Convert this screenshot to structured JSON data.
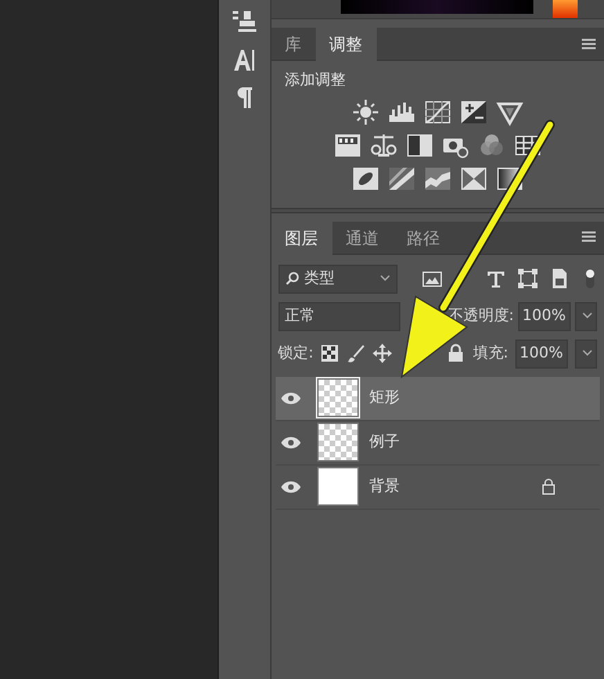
{
  "adjust_panel": {
    "tabs": [
      {
        "label": "库",
        "selected": false
      },
      {
        "label": "调整",
        "selected": true
      }
    ],
    "heading": "添加调整"
  },
  "layers_panel": {
    "tabs": [
      {
        "label": "图层",
        "selected": true
      },
      {
        "label": "通道",
        "selected": false
      },
      {
        "label": "路径",
        "selected": false
      }
    ],
    "filter": {
      "value": "类型"
    },
    "blend_mode": "正常",
    "opacity_label": "不透明度:",
    "opacity": "100%",
    "lock_label": "锁定:",
    "fill_label": "填充:",
    "fill": "100%",
    "layers": [
      {
        "name": "矩形",
        "selected": true,
        "visible": true,
        "locked": false,
        "kind": "transparent"
      },
      {
        "name": "例子",
        "selected": false,
        "visible": true,
        "locked": false,
        "kind": "transparent"
      },
      {
        "name": "背景",
        "selected": false,
        "visible": true,
        "locked": true,
        "kind": "white"
      }
    ]
  }
}
